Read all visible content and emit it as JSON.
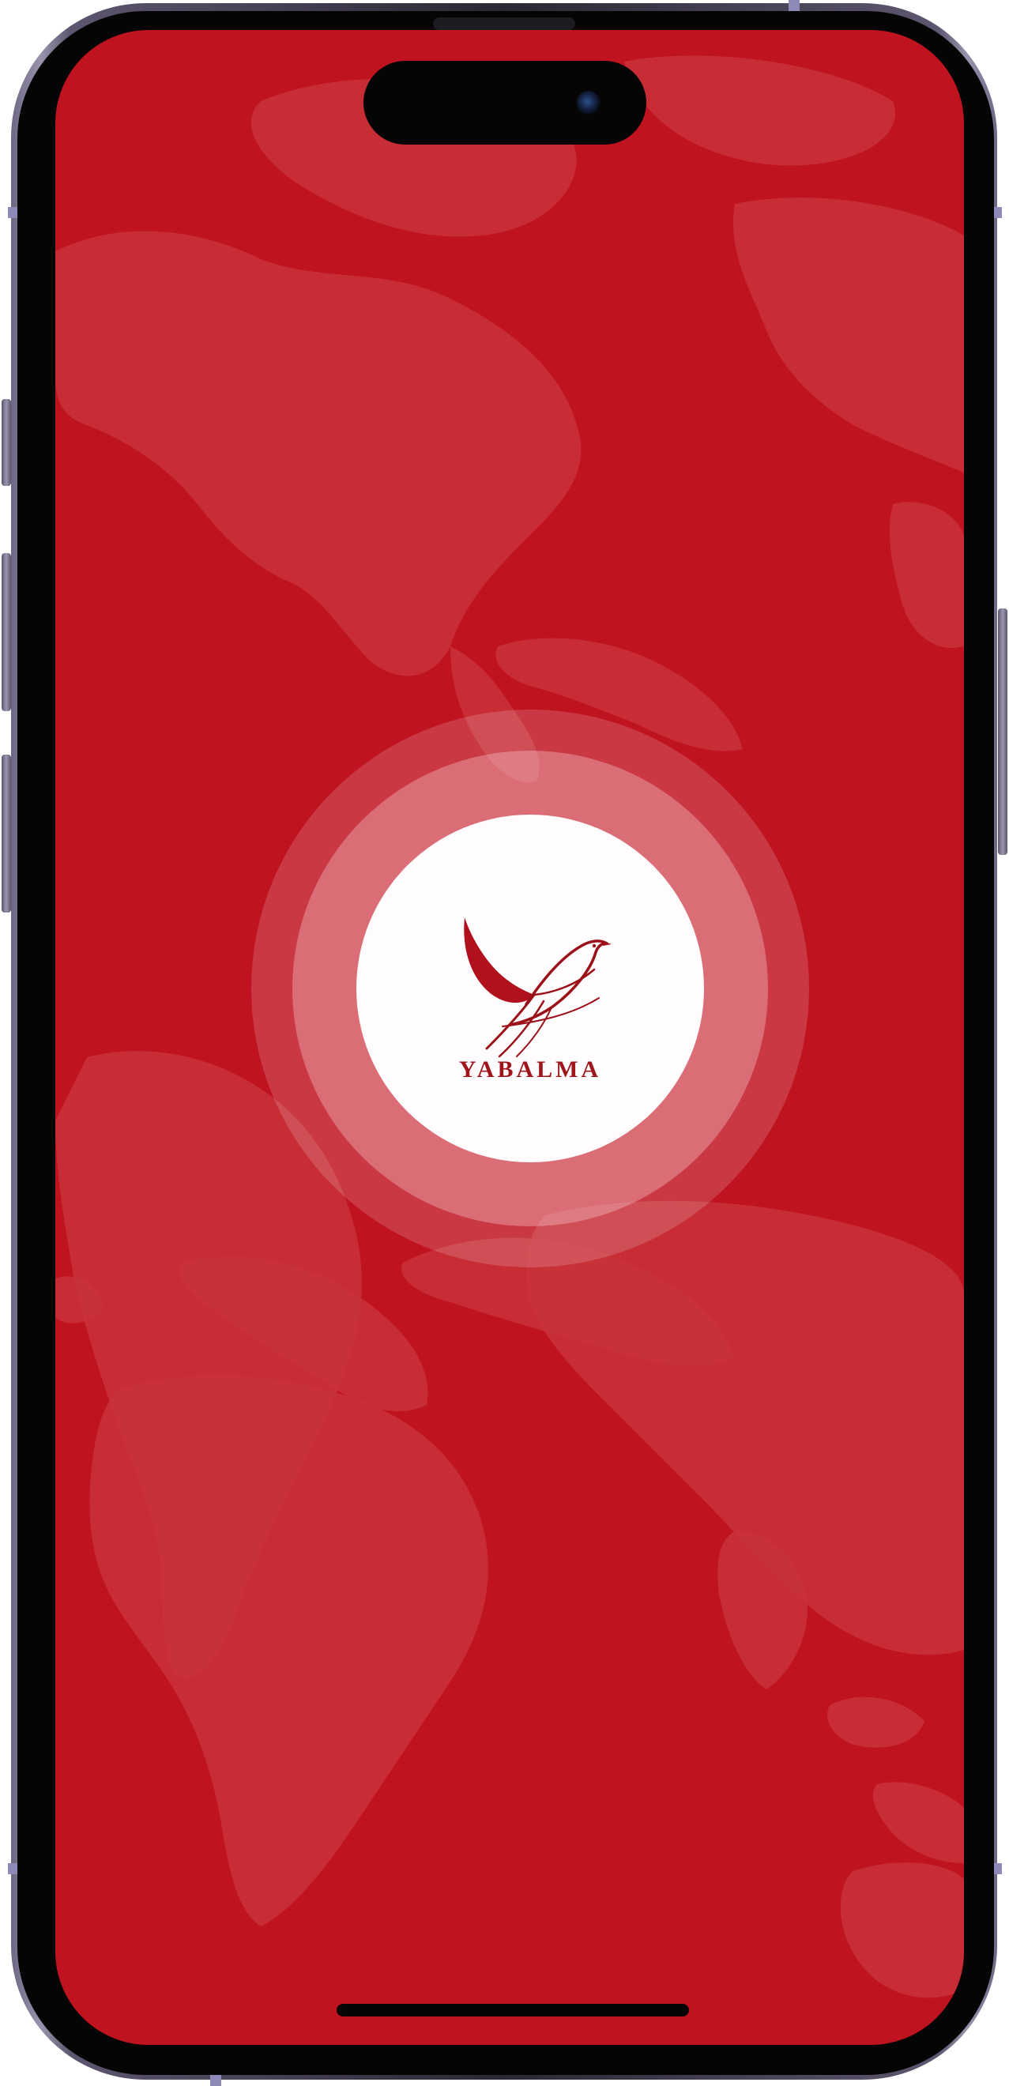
{
  "splash": {
    "brand_name": "YABALMA",
    "logo_icon": "bird-logo-icon",
    "background_icon": "world-map"
  },
  "colors": {
    "background": "#c01320",
    "map_land": "#c9323a",
    "logo_disc": "#fefcfc",
    "brand": "#a0141c"
  }
}
